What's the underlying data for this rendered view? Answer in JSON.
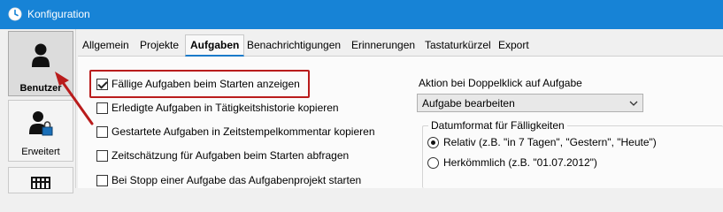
{
  "window": {
    "title": "Konfiguration"
  },
  "sidebar": {
    "items": [
      {
        "label": "Benutzer",
        "icon": "user-icon",
        "selected": true
      },
      {
        "label": "Erweitert",
        "icon": "user-lock-icon",
        "selected": false
      },
      {
        "label": "",
        "icon": "grid-icon",
        "selected": false
      }
    ]
  },
  "tabs": [
    {
      "label": "Allgemein",
      "active": false
    },
    {
      "label": "Projekte",
      "active": false
    },
    {
      "label": "Aufgaben",
      "active": true
    },
    {
      "label": "Benachrichtigungen",
      "active": false
    },
    {
      "label": "Erinnerungen",
      "active": false
    },
    {
      "label": "Tastaturkürzel",
      "active": false
    },
    {
      "label": "Export",
      "active": false
    }
  ],
  "options": [
    {
      "label": "Fällige Aufgaben beim Starten anzeigen",
      "checked": true
    },
    {
      "label": "Erledigte Aufgaben in Tätigkeitshistorie kopieren",
      "checked": false
    },
    {
      "label": "Gestartete Aufgaben in Zeitstempelkommentar kopieren",
      "checked": false
    },
    {
      "label": "Zeitschätzung für Aufgaben beim Starten abfragen",
      "checked": false
    },
    {
      "label": "Bei Stopp einer Aufgabe das Aufgabenprojekt starten",
      "checked": false
    }
  ],
  "doubleclick": {
    "label": "Aktion bei Doppelklick auf Aufgabe",
    "selected": "Aufgabe bearbeiten"
  },
  "dateformat": {
    "legend": "Datumformat für Fälligkeiten",
    "options": [
      {
        "label": "Relativ (z.B. \"in 7 Tagen\", \"Gestern\", \"Heute\")",
        "checked": true
      },
      {
        "label": "Herkömmlich (z.B. \"01.07.2012\")",
        "checked": false
      }
    ]
  },
  "colors": {
    "titlebar": "#1783d6",
    "highlight": "#b91c1c",
    "tab_accent": "#1a7ac9"
  }
}
